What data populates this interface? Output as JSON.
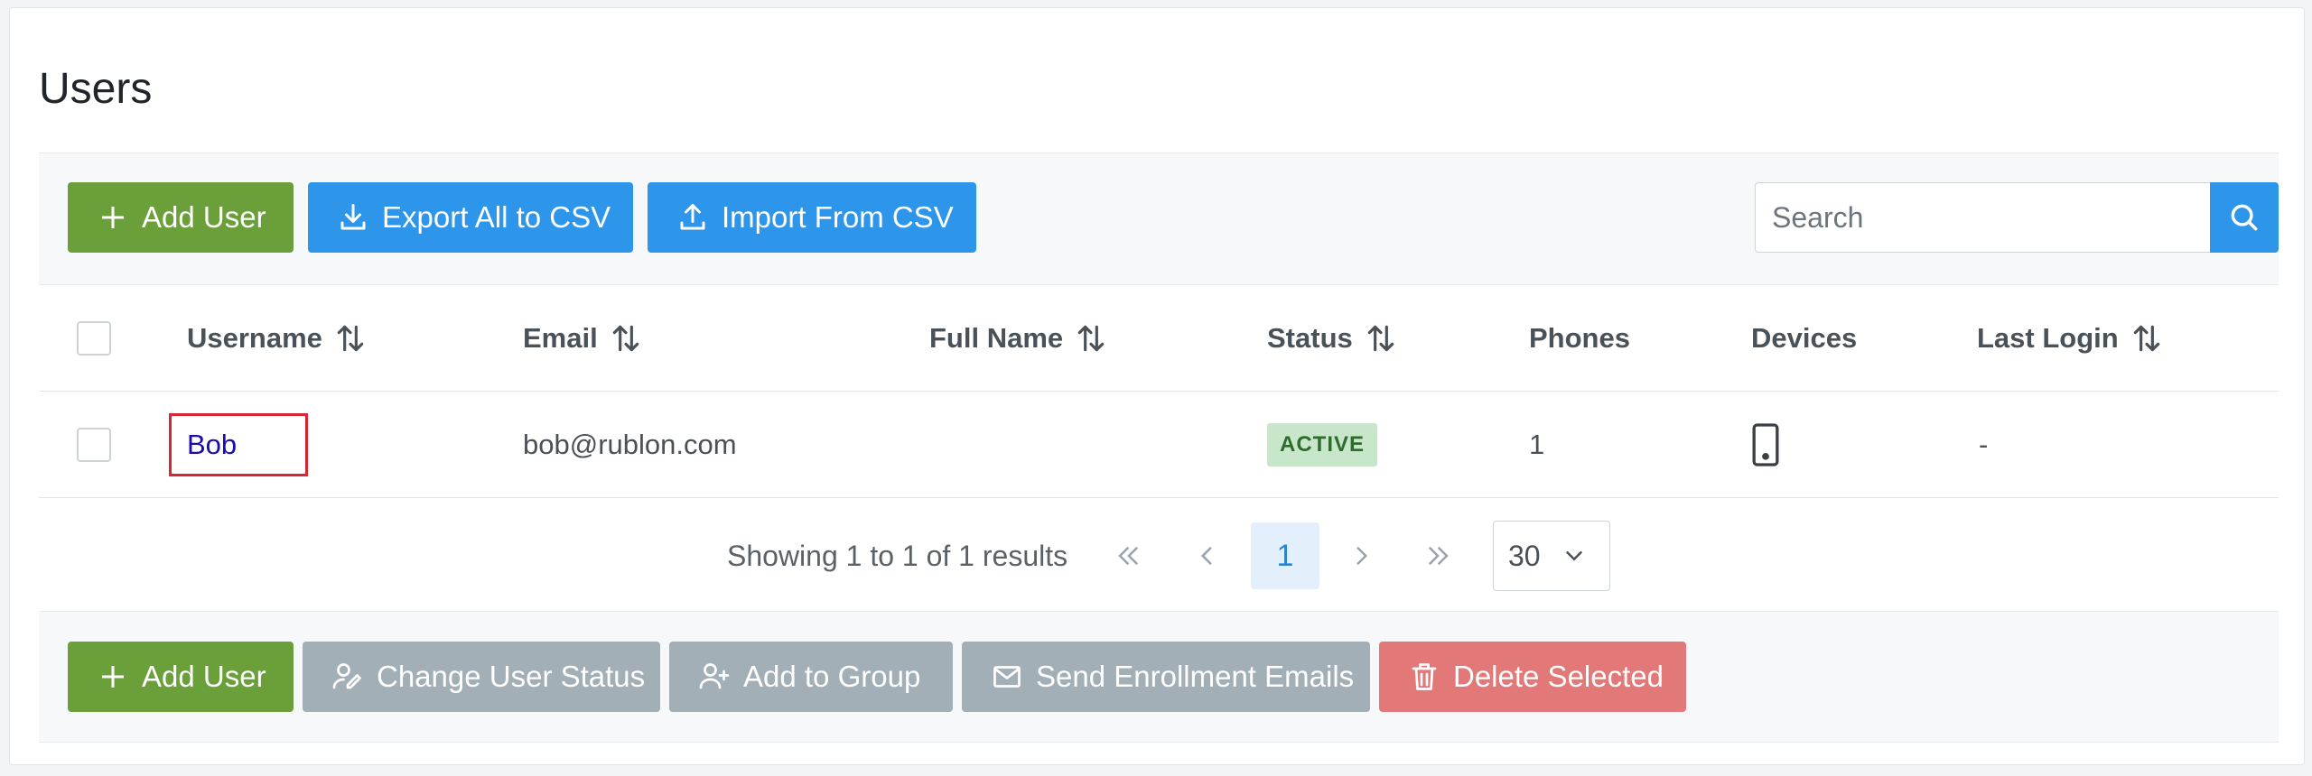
{
  "page": {
    "title": "Users"
  },
  "toolbar": {
    "add_user": "Add User",
    "export_csv": "Export All to CSV",
    "import_csv": "Import From CSV",
    "search_placeholder": "Search"
  },
  "table": {
    "columns": {
      "username": "Username",
      "email": "Email",
      "full_name": "Full Name",
      "status": "Status",
      "phones": "Phones",
      "devices": "Devices",
      "last_login": "Last Login"
    },
    "rows": [
      {
        "username": "Bob",
        "email": "bob@rublon.com",
        "full_name": "",
        "status": "ACTIVE",
        "phones": "1",
        "devices_icon": "smartphone-icon",
        "last_login": "-"
      }
    ]
  },
  "pagination": {
    "summary": "Showing 1 to 1 of 1 results",
    "current_page": "1",
    "per_page": "30"
  },
  "actions": {
    "add_user": "Add User",
    "change_status": "Change User Status",
    "add_to_group": "Add to Group",
    "send_enrollment": "Send Enrollment Emails",
    "delete_selected": "Delete Selected"
  },
  "colors": {
    "green": "#6a9f3a",
    "blue": "#2d95ea",
    "gray": "#a3afb6",
    "red": "#e27878",
    "status_active_bg": "#c8e6c9",
    "highlight_border": "#d72631"
  }
}
